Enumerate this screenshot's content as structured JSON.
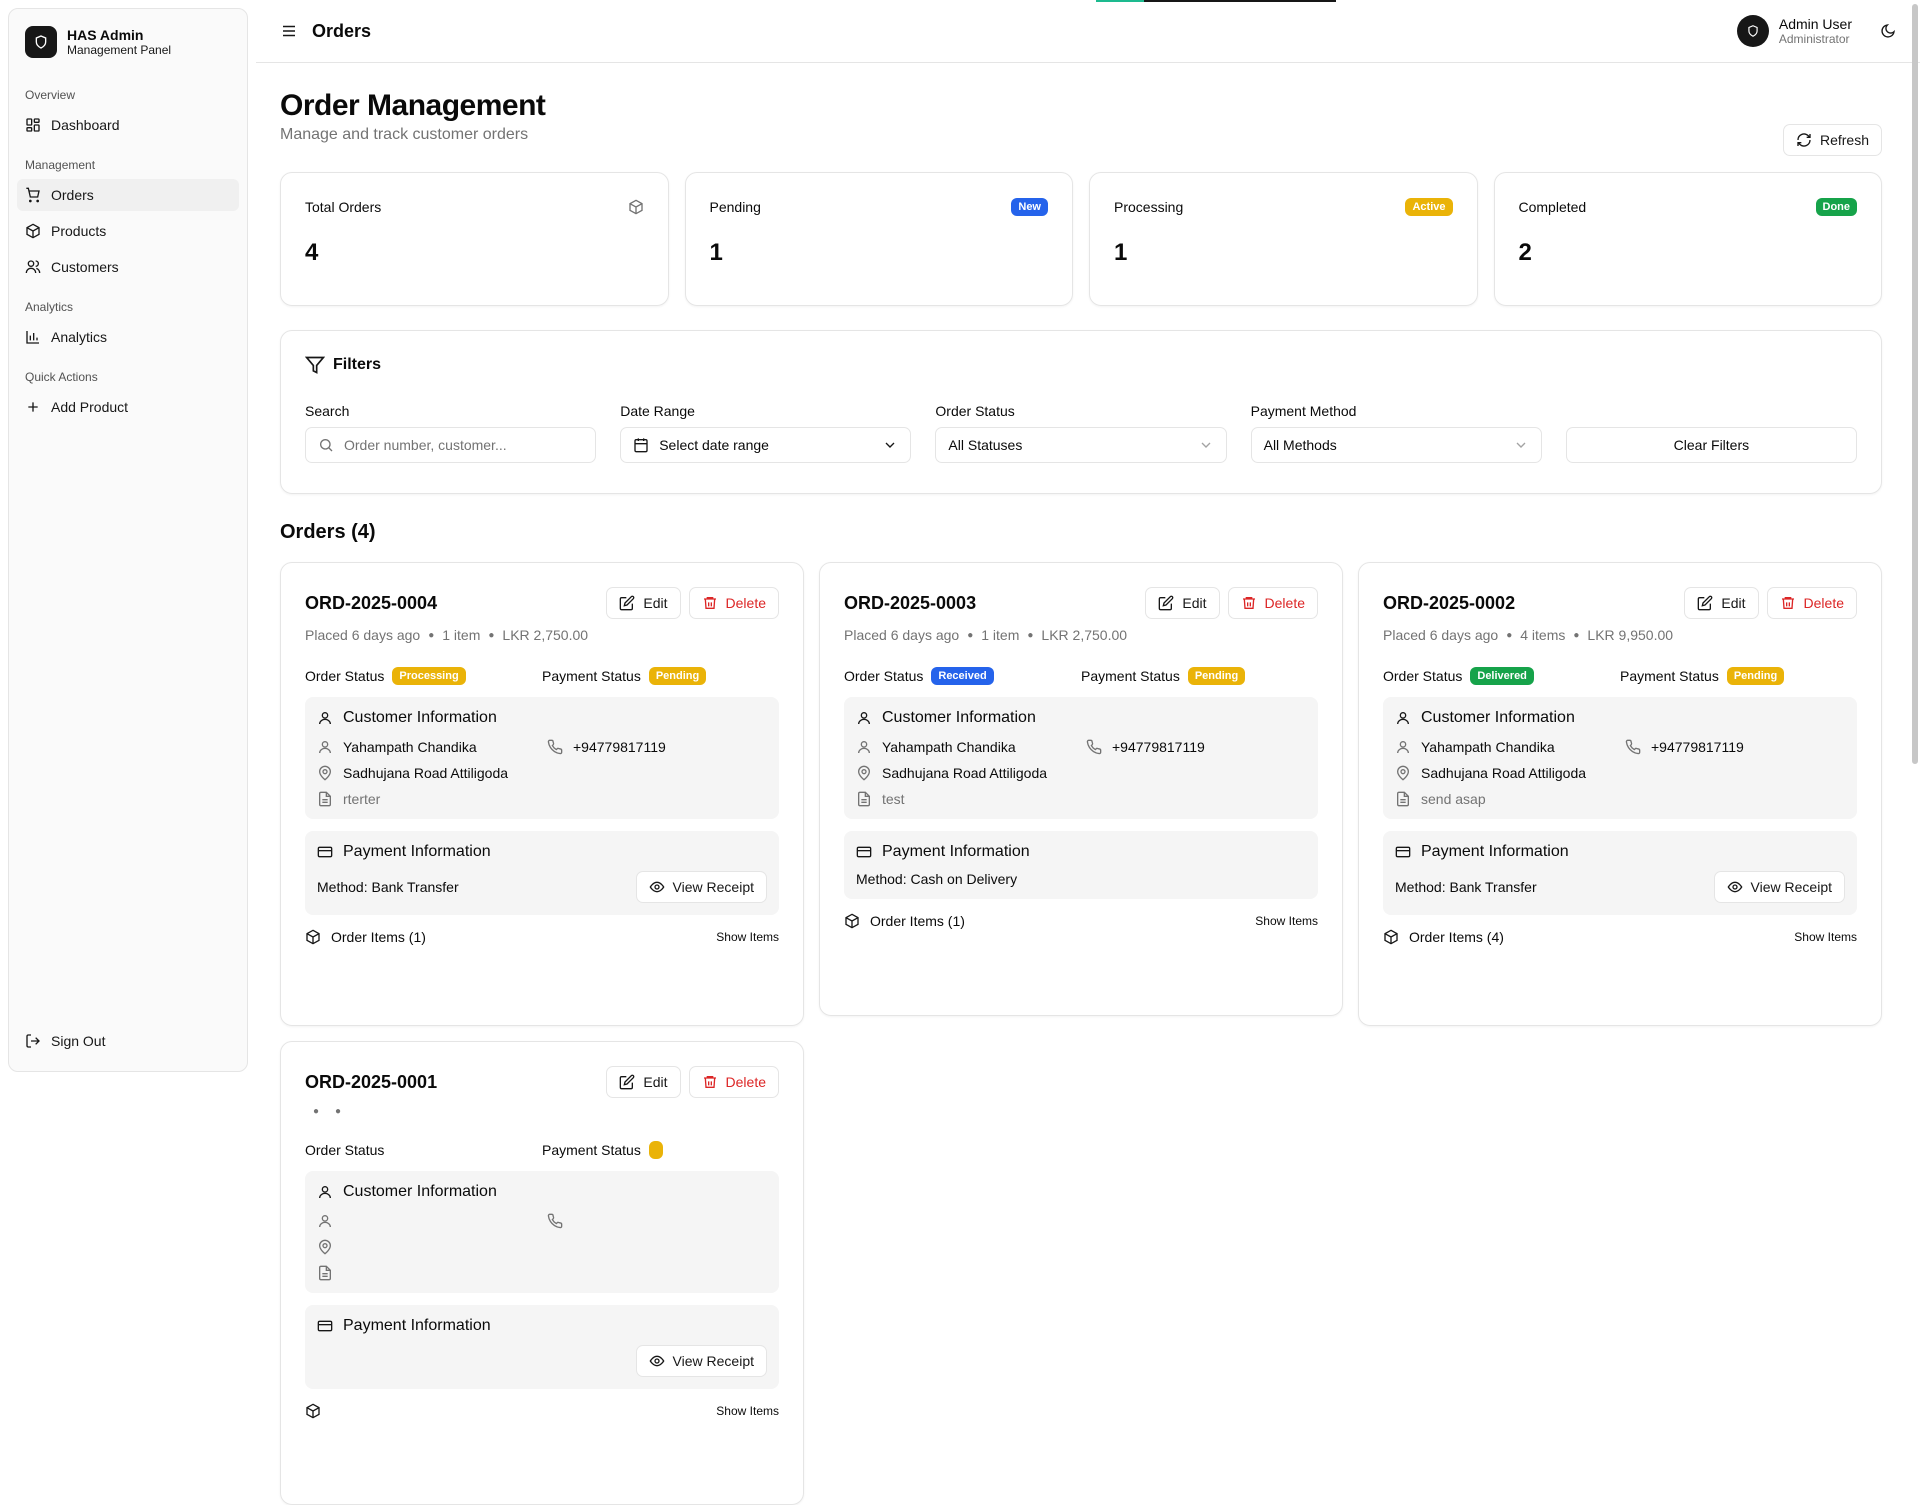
{
  "sidebar": {
    "brand_title": "HAS Admin",
    "brand_sub": "Management Panel",
    "groups": [
      {
        "label": "Overview",
        "items": [
          {
            "label": "Dashboard",
            "icon": "grid-icon"
          }
        ]
      },
      {
        "label": "Management",
        "items": [
          {
            "label": "Orders",
            "icon": "cart-icon"
          },
          {
            "label": "Products",
            "icon": "package-icon"
          },
          {
            "label": "Customers",
            "icon": "users-icon"
          }
        ]
      },
      {
        "label": "Analytics",
        "items": [
          {
            "label": "Analytics",
            "icon": "bar-chart-icon"
          }
        ]
      },
      {
        "label": "Quick Actions",
        "items": [
          {
            "label": "Add Product",
            "icon": "plus-icon"
          }
        ]
      }
    ],
    "sign_out": "Sign Out"
  },
  "header": {
    "title": "Orders",
    "user_name": "Admin User",
    "user_role": "Administrator"
  },
  "page": {
    "title": "Order Management",
    "subtitle": "Manage and track customer orders",
    "refresh_label": "Refresh"
  },
  "stats": [
    {
      "label": "Total Orders",
      "value": "4",
      "badge": ""
    },
    {
      "label": "Pending",
      "value": "1",
      "badge": "New"
    },
    {
      "label": "Processing",
      "value": "1",
      "badge": "Active"
    },
    {
      "label": "Completed",
      "value": "2",
      "badge": "Done"
    }
  ],
  "filters": {
    "title": "Filters",
    "search_label": "Search",
    "search_placeholder": "Order number, customer...",
    "date_label": "Date Range",
    "date_value": "Select date range",
    "status_label": "Order Status",
    "status_value": "All Statuses",
    "payment_label": "Payment Method",
    "payment_value": "All Methods",
    "clear_label": "Clear Filters"
  },
  "orders_title": "Orders (4)",
  "card_labels": {
    "edit": "Edit",
    "delete": "Delete",
    "order_status": "Order Status",
    "payment_status": "Payment Status",
    "customer_info": "Customer Information",
    "payment_info": "Payment Information",
    "view_receipt": "View Receipt",
    "show_items": "Show Items"
  },
  "orders": [
    {
      "number": "ORD-2025-0004",
      "placed": "Placed 6 days ago",
      "items": "1 item",
      "total": "LKR 2,750.00",
      "order_status": "Processing",
      "payment_status": "Pending",
      "customer": "Yahampath Chandika",
      "phone": "+94779817119",
      "address": "Sadhujana Road Attiligoda",
      "note": "rterter",
      "method": "Method: Bank Transfer",
      "order_items": "Order Items (1)"
    },
    {
      "number": "ORD-2025-0003",
      "placed": "Placed 6 days ago",
      "items": "1 item",
      "total": "LKR 2,750.00",
      "order_status": "Received",
      "payment_status": "Pending",
      "customer": "Yahampath Chandika",
      "phone": "+94779817119",
      "address": "Sadhujana Road Attiligoda",
      "note": "test",
      "method": "Method: Cash on Delivery",
      "order_items": "Order Items (1)"
    },
    {
      "number": "ORD-2025-0002",
      "placed": "Placed 6 days ago",
      "items": "4 items",
      "total": "LKR 9,950.00",
      "order_status": "Delivered",
      "payment_status": "Pending",
      "customer": "Yahampath Chandika",
      "phone": "+94779817119",
      "address": "Sadhujana Road Attiligoda",
      "note": "send asap",
      "method": "Method: Bank Transfer",
      "order_items": "Order Items (4)"
    },
    {
      "number": "ORD-2025-0001",
      "placed": "",
      "items": "",
      "total": "",
      "order_status": "",
      "payment_status": "",
      "customer": "",
      "phone": "",
      "address": "",
      "note": "",
      "method": "",
      "order_items": ""
    }
  ],
  "colors": {
    "accent": "#171717",
    "blue_badge": "#2563eb",
    "amber_badge": "#eab308",
    "green_badge": "#16a34a",
    "danger": "#dc2626"
  }
}
